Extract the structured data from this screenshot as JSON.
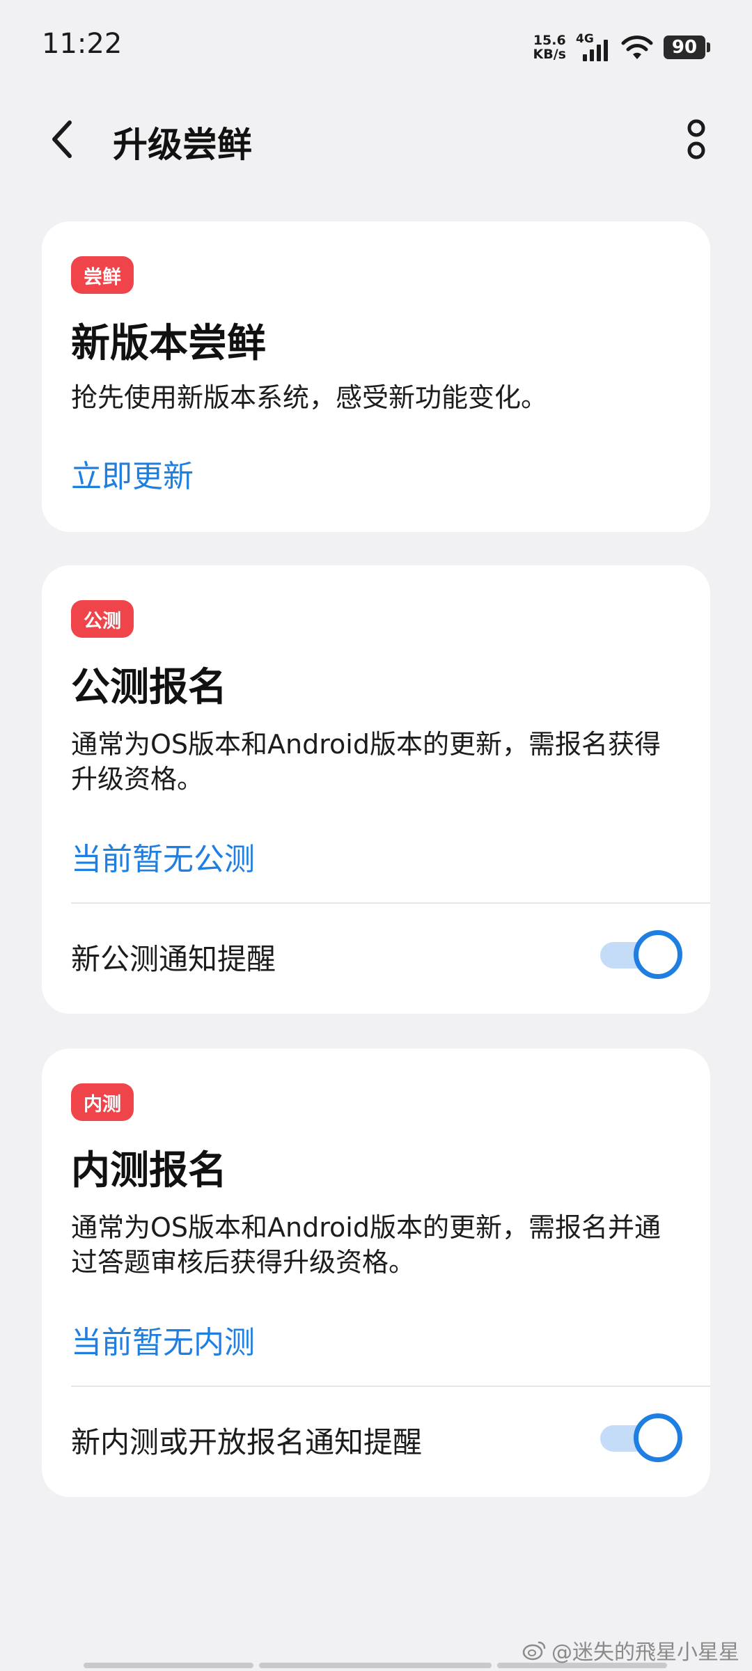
{
  "status_bar": {
    "time": "11:22",
    "net_speed_value": "15.6",
    "net_speed_unit": "KB/s",
    "network_type": "4G",
    "battery": "90"
  },
  "header": {
    "title": "升级尝鲜",
    "back_icon": "chevron-left-icon",
    "more_icon": "more-vertical-icon"
  },
  "cards": [
    {
      "badge": "尝鲜",
      "title": "新版本尝鲜",
      "description": "抢先使用新版本系统，感受新功能变化。",
      "link": "立即更新"
    },
    {
      "badge": "公测",
      "title": "公测报名",
      "description": "通常为OS版本和Android版本的更新，需报名获得升级资格。",
      "link": "当前暂无公测",
      "toggle_label": "新公测通知提醒",
      "toggle_on": true
    },
    {
      "badge": "内测",
      "title": "内测报名",
      "description": "通常为OS版本和Android版本的更新，需报名并通过答题审核后获得升级资格。",
      "link": "当前暂无内测",
      "toggle_label": "新内测或开放报名通知提醒",
      "toggle_on": true
    }
  ],
  "watermark": "@迷失的飛星小星星",
  "colors": {
    "accent": "#1f7fe0",
    "badge": "#f0444b",
    "background": "#f1f1f3"
  }
}
